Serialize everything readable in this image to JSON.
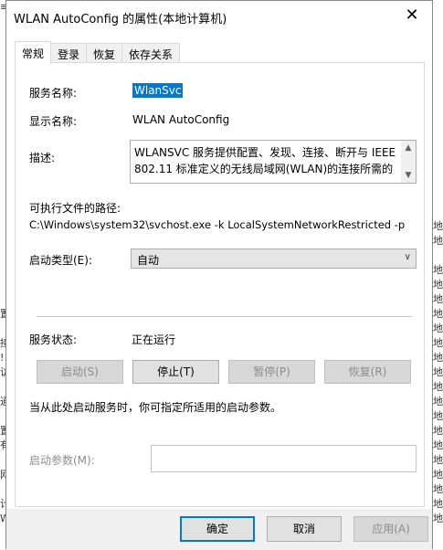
{
  "window": {
    "title": "WLAN AutoConfig 的属性(本地计算机)",
    "close_glyph": "✕"
  },
  "tabs": [
    {
      "label": "常规"
    },
    {
      "label": "登录"
    },
    {
      "label": "恢复"
    },
    {
      "label": "依存关系"
    }
  ],
  "general": {
    "service_name_label": "服务名称:",
    "service_name": "WlanSvc",
    "display_name_label": "显示名称:",
    "display_name": "WLAN AutoConfig",
    "description_label": "描述:",
    "description": "WLANSVC 服务提供配置、发现、连接、断开与 IEEE 802.11 标准定义的无线局域网(WLAN)的连接所需的",
    "exe_path_label": "可执行文件的路径:",
    "exe_path": "C:\\Windows\\system32\\svchost.exe -k LocalSystemNetworkRestricted -p",
    "startup_type_label": "启动类型(E):",
    "startup_type_value": "自动",
    "service_status_label": "服务状态:",
    "service_status": "正在运行",
    "start_button": "启动(S)",
    "stop_button": "停止(T)",
    "pause_button": "暂停(P)",
    "resume_button": "恢复(R)",
    "hint": "当从此处启动服务时，你可指定所适用的启动参数。",
    "start_params_label": "启动参数(M):",
    "start_params_value": ""
  },
  "footer": {
    "ok_button": "确定",
    "cancel_button": "取消",
    "apply_button": "应用(A)"
  },
  "background": {
    "left_fragments": [
      "≡",
      "",
      "",
      "",
      "",
      "",
      "",
      "",
      "",
      "",
      "",
      "",
      "",
      "",
      "",
      "",
      "",
      "",
      "",
      "",
      "",
      "置",
      "",
      "接",
      "!",
      "访",
      "",
      "通",
      "",
      "置",
      "有",
      "",
      "网",
      "",
      "计",
      "W"
    ],
    "right_fragments": [
      "",
      "",
      "",
      "",
      "",
      "",
      "",
      "",
      "",
      "",
      "",
      "",
      "",
      "",
      "",
      "地",
      "地",
      "",
      "地",
      "地",
      "地",
      "地",
      "地",
      "地",
      "地",
      "地",
      "地",
      "地",
      "地",
      "地",
      "地",
      "地",
      "地",
      "地",
      "地",
      "地"
    ]
  }
}
